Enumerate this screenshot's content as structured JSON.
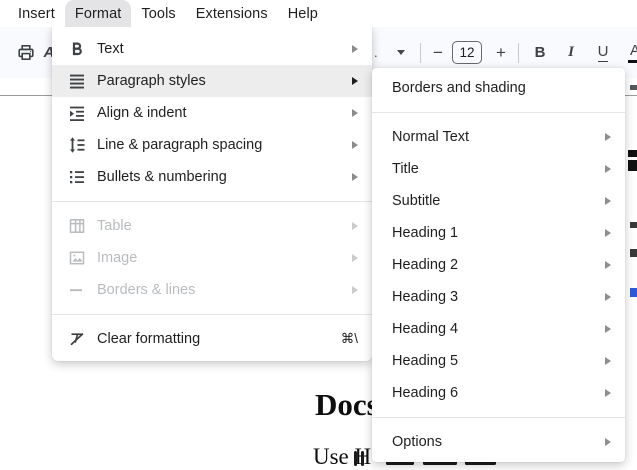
{
  "menubar": {
    "items": [
      {
        "label": "Insert"
      },
      {
        "label": "Format",
        "active": true
      },
      {
        "label": "Tools"
      },
      {
        "label": "Extensions"
      },
      {
        "label": "Help"
      }
    ]
  },
  "toolbar": {
    "spellcheck_glyph": "A",
    "font_name_truncated": "..",
    "decrease_font_label": "−",
    "font_size_value": "12",
    "increase_font_label": "+",
    "bold_label": "B",
    "italic_label": "I",
    "underline_label": "U",
    "text_color_label": "A",
    "text_color_bar_hex": "#111111"
  },
  "format_menu": {
    "items": [
      {
        "label": "Text",
        "icon": "bold-icon",
        "has_submenu": true
      },
      {
        "label": "Paragraph styles",
        "icon": "paragraph-styles-icon",
        "has_submenu": true,
        "highlighted": true
      },
      {
        "label": "Align & indent",
        "icon": "align-indent-icon",
        "has_submenu": true
      },
      {
        "label": "Line & paragraph spacing",
        "icon": "line-spacing-icon",
        "has_submenu": true
      },
      {
        "label": "Bullets & numbering",
        "icon": "bullets-numbering-icon",
        "has_submenu": true
      },
      {
        "label": "Table",
        "icon": "table-icon",
        "has_submenu": true,
        "disabled": true
      },
      {
        "label": "Image",
        "icon": "image-icon",
        "has_submenu": true,
        "disabled": true
      },
      {
        "label": "Borders & lines",
        "icon": "borders-lines-icon",
        "has_submenu": true,
        "disabled": true
      },
      {
        "label": "Clear formatting",
        "icon": "clear-formatting-icon",
        "shortcut": "⌘\\"
      }
    ]
  },
  "paragraph_styles_submenu": {
    "items": [
      {
        "label": "Borders and shading"
      },
      {
        "label": "Normal Text",
        "has_submenu": true
      },
      {
        "label": "Title",
        "has_submenu": true
      },
      {
        "label": "Subtitle",
        "has_submenu": true
      },
      {
        "label": "Heading 1",
        "has_submenu": true
      },
      {
        "label": "Heading 2",
        "has_submenu": true
      },
      {
        "label": "Heading 3",
        "has_submenu": true
      },
      {
        "label": "Heading 4",
        "has_submenu": true
      },
      {
        "label": "Heading 5",
        "has_submenu": true
      },
      {
        "label": "Heading 6",
        "has_submenu": true
      },
      {
        "label": "Options",
        "has_submenu": true
      }
    ]
  },
  "document": {
    "title": "Docs",
    "visible_text_fragment": "Use H"
  },
  "colors": {
    "menubar_active_bg": "#e4e4e6",
    "toolbar_bg": "#f8fafd",
    "menu_highlight_bg": "#ededed",
    "disabled_text": "#b9bcbf",
    "text": "#1f1f1f"
  }
}
